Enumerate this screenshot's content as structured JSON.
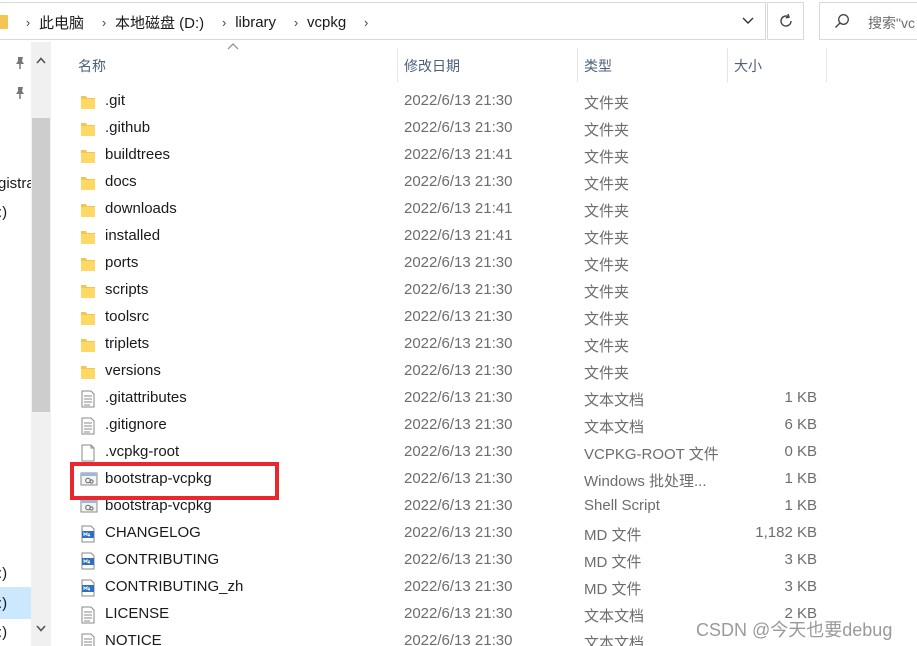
{
  "address_bar": {
    "breadcrumbs": [
      "此电脑",
      "本地磁盘 (D:)",
      "library",
      "vcpkg"
    ]
  },
  "search": {
    "placeholder": "搜索\"vc"
  },
  "nav_pane": {
    "partial_labels": [
      "gistra",
      ":)",
      ":)",
      ":)",
      ":)"
    ]
  },
  "columns": {
    "name": "名称",
    "date": "修改日期",
    "type": "类型",
    "size": "大小"
  },
  "files": [
    {
      "name": ".git",
      "date": "2022/6/13 21:30",
      "type": "文件夹",
      "size": "",
      "icon": "folder-icon"
    },
    {
      "name": ".github",
      "date": "2022/6/13 21:30",
      "type": "文件夹",
      "size": "",
      "icon": "folder-icon"
    },
    {
      "name": "buildtrees",
      "date": "2022/6/13 21:41",
      "type": "文件夹",
      "size": "",
      "icon": "folder-icon"
    },
    {
      "name": "docs",
      "date": "2022/6/13 21:30",
      "type": "文件夹",
      "size": "",
      "icon": "folder-icon"
    },
    {
      "name": "downloads",
      "date": "2022/6/13 21:41",
      "type": "文件夹",
      "size": "",
      "icon": "folder-icon"
    },
    {
      "name": "installed",
      "date": "2022/6/13 21:41",
      "type": "文件夹",
      "size": "",
      "icon": "folder-icon"
    },
    {
      "name": "ports",
      "date": "2022/6/13 21:30",
      "type": "文件夹",
      "size": "",
      "icon": "folder-icon"
    },
    {
      "name": "scripts",
      "date": "2022/6/13 21:30",
      "type": "文件夹",
      "size": "",
      "icon": "folder-icon"
    },
    {
      "name": "toolsrc",
      "date": "2022/6/13 21:30",
      "type": "文件夹",
      "size": "",
      "icon": "folder-icon"
    },
    {
      "name": "triplets",
      "date": "2022/6/13 21:30",
      "type": "文件夹",
      "size": "",
      "icon": "folder-icon"
    },
    {
      "name": "versions",
      "date": "2022/6/13 21:30",
      "type": "文件夹",
      "size": "",
      "icon": "folder-icon"
    },
    {
      "name": ".gitattributes",
      "date": "2022/6/13 21:30",
      "type": "文本文档",
      "size": "1 KB",
      "icon": "text-document-icon"
    },
    {
      "name": ".gitignore",
      "date": "2022/6/13 21:30",
      "type": "文本文档",
      "size": "6 KB",
      "icon": "text-document-icon"
    },
    {
      "name": ".vcpkg-root",
      "date": "2022/6/13 21:30",
      "type": "VCPKG-ROOT 文件",
      "size": "0 KB",
      "icon": "blank-file-icon"
    },
    {
      "name": "bootstrap-vcpkg",
      "date": "2022/6/13 21:30",
      "type": "Windows 批处理...",
      "size": "1 KB",
      "icon": "script-file-icon",
      "highlighted": true
    },
    {
      "name": "bootstrap-vcpkg",
      "date": "2022/6/13 21:30",
      "type": "Shell Script",
      "size": "1 KB",
      "icon": "script-file-icon"
    },
    {
      "name": "CHANGELOG",
      "date": "2022/6/13 21:30",
      "type": "MD 文件",
      "size": "1,182 KB",
      "icon": "markdown-file-icon"
    },
    {
      "name": "CONTRIBUTING",
      "date": "2022/6/13 21:30",
      "type": "MD 文件",
      "size": "3 KB",
      "icon": "markdown-file-icon"
    },
    {
      "name": "CONTRIBUTING_zh",
      "date": "2022/6/13 21:30",
      "type": "MD 文件",
      "size": "3 KB",
      "icon": "markdown-file-icon"
    },
    {
      "name": "LICENSE",
      "date": "2022/6/13 21:30",
      "type": "文本文档",
      "size": "2 KB",
      "icon": "text-document-icon"
    },
    {
      "name": "NOTICE",
      "date": "2022/6/13 21:30",
      "type": "文本文档",
      "size": "",
      "icon": "text-document-icon"
    }
  ],
  "colors": {
    "folder": "#f3c651",
    "highlight_border": "#e8282d",
    "header_text": "#4c607a",
    "nav_selection": "#cce8ff"
  },
  "watermark": "CSDN @今天也要debug"
}
